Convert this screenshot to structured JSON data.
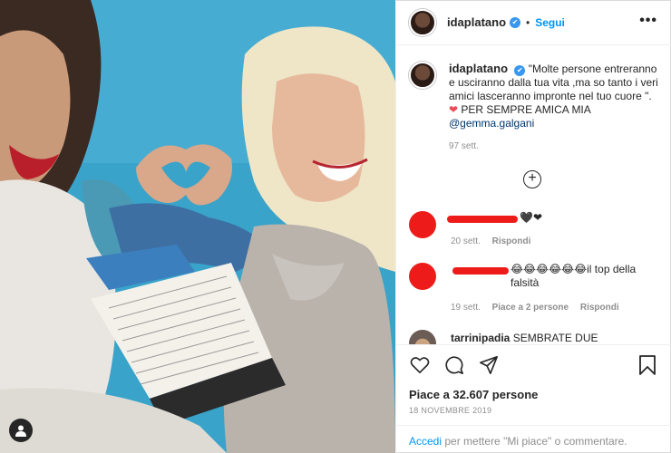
{
  "post": {
    "username": "idaplatano",
    "verified_icon": "verified-badge-icon",
    "separator": "•",
    "follow_label": "Segui",
    "more_icon": "more-options-icon"
  },
  "caption": {
    "username": "idaplatano",
    "text_part1": "\"Molte persone entreranno e usciranno dalla tua vita ,ma so tanto i veri amici lasceranno impronte nel tuo cuore \".",
    "heart": "❤",
    "text_part2": "PER SEMPRE AMICA MIA",
    "mention": "@gemma.galgani",
    "time": "97 sett."
  },
  "load_more_icon": "plus-circle-icon",
  "comments": [
    {
      "text": "🖤❤",
      "time": "20 sett.",
      "reply": "Rispondi"
    },
    {
      "text_emojis": "😂😂😂😂😂😂",
      "text_suffix": "il top della falsità",
      "time": "19 sett.",
      "likes": "Piace a 2 persone",
      "reply": "Rispondi"
    },
    {
      "username": "tarrinipadia",
      "text": "SEMBRATE DUE"
    }
  ],
  "actions": {
    "like_icon": "heart-icon",
    "comment_icon": "comment-icon",
    "share_icon": "share-icon",
    "save_icon": "bookmark-icon",
    "likes_text": "Piace a 32.607 persone",
    "date": "18 NOVEMBRE 2019"
  },
  "add_comment": {
    "link": "Accedi",
    "rest": "per mettere \"Mi piace\" o commentare."
  },
  "photo": {
    "user_tag_icon": "user-tag-icon"
  }
}
